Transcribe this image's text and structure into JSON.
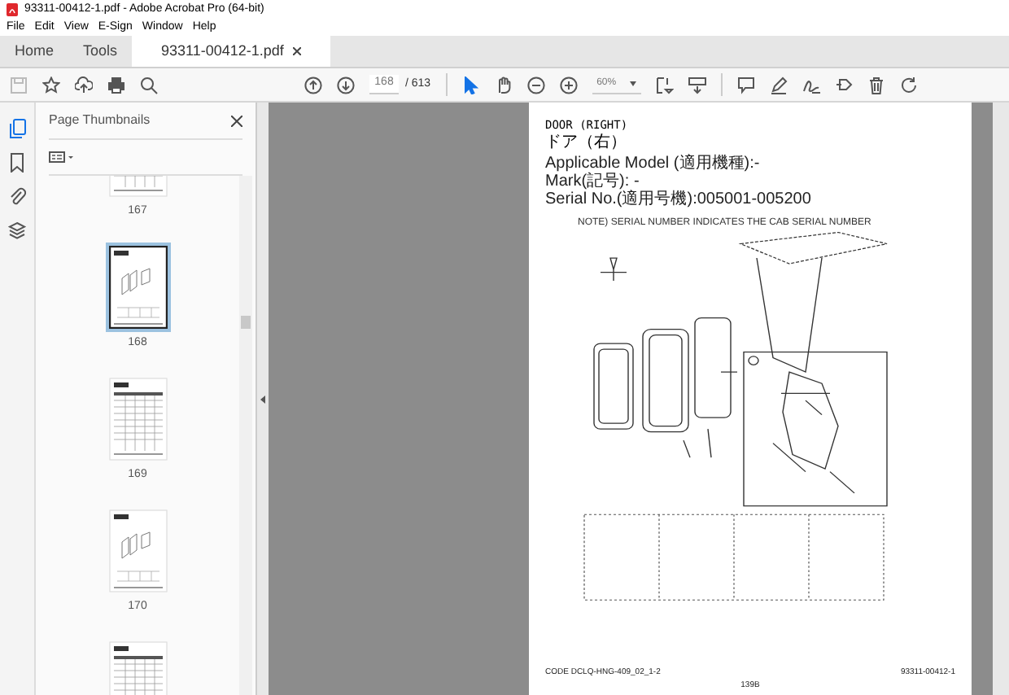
{
  "window": {
    "title": "93311-00412-1.pdf - Adobe Acrobat Pro (64-bit)"
  },
  "menu": [
    "File",
    "Edit",
    "View",
    "E-Sign",
    "Window",
    "Help"
  ],
  "tabs": [
    {
      "label": "Home",
      "selected": false,
      "closable": false
    },
    {
      "label": "Tools",
      "selected": false,
      "closable": false
    },
    {
      "label": "93311-00412-1.pdf",
      "selected": true,
      "closable": true
    }
  ],
  "toolbar": {
    "page_number": "168",
    "page_total": "/ 613",
    "zoom": "60%",
    "tools": [
      {
        "kind": "select",
        "selected": true
      },
      {
        "kind": "hand",
        "selected": false
      }
    ]
  },
  "side_rail": [
    {
      "kind": "pages",
      "selected": true
    },
    {
      "kind": "bookmark",
      "selected": false
    },
    {
      "kind": "attachment",
      "selected": false
    },
    {
      "kind": "layers",
      "selected": false
    }
  ],
  "thumbnails": {
    "title": "Page Thumbnails",
    "pages": [
      {
        "label": "167",
        "kind": "table",
        "selected": false
      },
      {
        "label": "168",
        "kind": "diagram",
        "selected": true
      },
      {
        "label": "169",
        "kind": "table",
        "selected": false
      },
      {
        "label": "170",
        "kind": "diagram",
        "selected": false
      },
      {
        "kind": "table",
        "selected": false
      }
    ]
  },
  "document": {
    "title": "DOOR (RIGHT)",
    "title_ja": "ドア（右）",
    "details": [
      "Applicable Model (適用機種):-",
      "Mark(記号): -",
      "Serial No.(適用号機):005001-005200"
    ],
    "note": "NOTE) SERIAL NUMBER INDICATES THE CAB SERIAL NUMBER",
    "footer_code": "CODE DCLQ-HNG-409_02_1-2",
    "footer_part": "93311-00412-1",
    "page_label": "139B"
  }
}
